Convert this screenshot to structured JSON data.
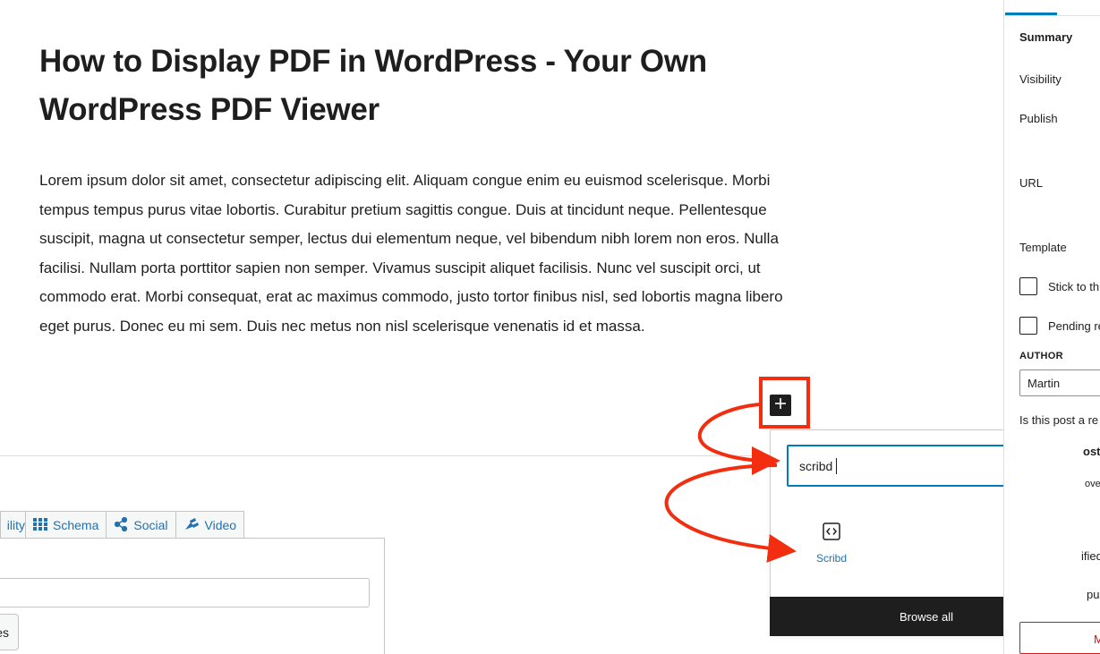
{
  "post": {
    "title": "How to Display PDF in WordPress - Your Own WordPress PDF Viewer",
    "body": "Lorem ipsum dolor sit amet, consectetur adipiscing elit. Aliquam congue enim eu euismod scelerisque. Morbi tempus tempus purus vitae lobortis. Curabitur pretium sagittis congue. Duis at tincidunt neque. Pellentesque suscipit, magna ut consectetur semper, lectus dui elementum neque, vel bibendum nibh lorem non eros. Nulla facilisi. Nullam porta porttitor sapien non semper. Vivamus suscipit aliquet facilisis. Nunc vel suscipit orci, ut commodo erat. Morbi consequat, erat ac maximus commodo, justo tortor finibus nisl, sed lobortis magna libero eget purus. Donec eu mi sem. Duis nec metus non nisl scelerisque venenatis id et massa."
  },
  "inserter": {
    "search_value": "scribd",
    "clear_icon": "close-icon",
    "result_label": "Scribd",
    "result_icon": "embed-icon",
    "browse_all_label": "Browse all",
    "add_icon": "plus-icon"
  },
  "metabox": {
    "tabs": [
      {
        "label": "ility",
        "icon": ""
      },
      {
        "label": "Schema",
        "icon": "grid-icon"
      },
      {
        "label": "Social",
        "icon": "share-icon"
      },
      {
        "label": "Video",
        "icon": "video-icon"
      }
    ],
    "button_label": "es"
  },
  "sidebar": {
    "summary": "Summary",
    "visibility": "Visibility",
    "publish": "Publish",
    "url": "URL",
    "template": "Template",
    "stick_label": "Stick to th",
    "pending_label": "Pending re",
    "author_heading": "AUTHOR",
    "author_value": "Martin",
    "repost_question": "Is this post a re",
    "frag_ost": "ost",
    "frag_ove": "ove",
    "frag_ified": "ified",
    "frag_pu": "pu",
    "danger_fragment": "M"
  },
  "colors": {
    "accent": "#007cba",
    "link": "#2271b1",
    "annotation": "#f22d10",
    "dark": "#1e1e1e"
  }
}
